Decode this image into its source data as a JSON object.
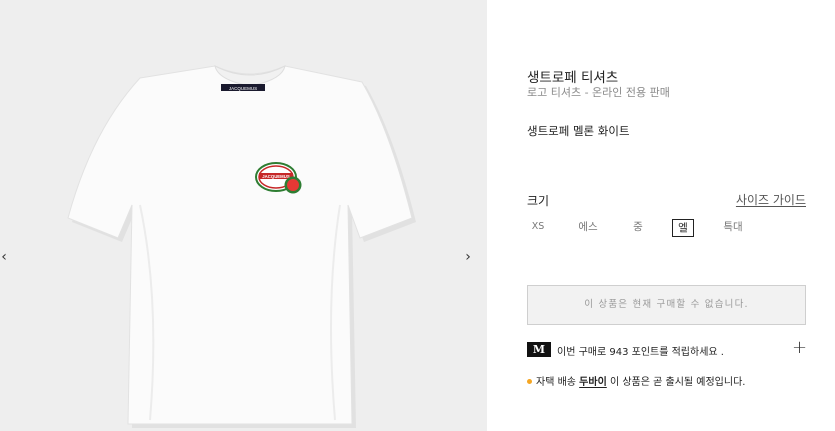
{
  "gallery": {
    "prev_glyph": "‹",
    "next_glyph": "›",
    "image": {
      "description_icon": "white-tshirt-image",
      "neck_label": "JACQUEMUS",
      "patch_text": "JACQUEMUS"
    }
  },
  "product": {
    "title": "생트로페 티셔츠",
    "subtitle": "로고 티셔츠 - 온라인 전용 판매",
    "color_name": "생트로페 멜론 화이트"
  },
  "size": {
    "label": "크기",
    "guide_label": "사이즈 가이드",
    "options": [
      "XS",
      "에스",
      "중",
      "엘",
      "특대"
    ],
    "selected": "엘"
  },
  "purchase": {
    "unavailable_text": "이 상품은 현재 구매할 수 없습니다."
  },
  "points": {
    "badge": "M",
    "text": "이번 구매로 943 포인트를 적립하세요 .",
    "plus_glyph": "+"
  },
  "shipping": {
    "prefix": "자택 배송",
    "city": "두바이",
    "suffix": "이 상품은 곧 출시될 예정입니다."
  },
  "colors": {
    "gallery_bg": "#eeeeee",
    "dot": "#f5a623",
    "badge_bg": "#111111"
  }
}
